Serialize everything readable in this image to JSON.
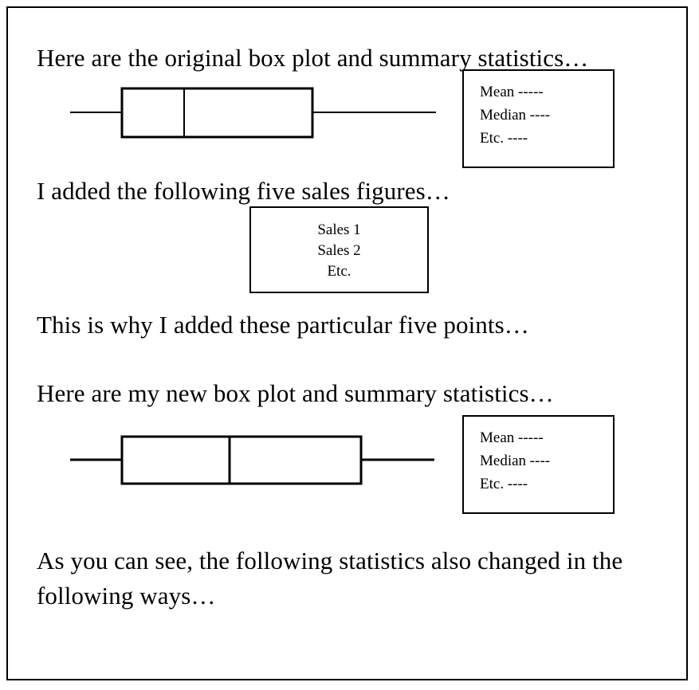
{
  "document": {
    "title": "Box plot comparison slide",
    "border_color": "#000000",
    "background_color": "#ffffff",
    "text_color": "#000000"
  },
  "paragraphs": [
    {
      "id": "line-1",
      "text": "Here are the original box plot and summary statistics…"
    },
    {
      "id": "line-2",
      "text": "I added the following five sales figures…"
    },
    {
      "id": "line-3",
      "text": "This is why I added these particular five points…"
    },
    {
      "id": "line-4",
      "text": "Here are my new box plot and summary statistics…"
    },
    {
      "id": "line-5",
      "text": "As you can see, the following statistics also changed in the following ways…"
    }
  ],
  "stats_box_original": {
    "lines": [
      "Mean -----",
      "Median ----",
      "Etc. ----"
    ]
  },
  "stats_box_new": {
    "lines": [
      "Mean -----",
      "Median ----",
      "Etc. ----"
    ]
  },
  "sales_box": {
    "lines": [
      "Sales 1",
      "Sales 2",
      "Etc."
    ]
  },
  "chart_data": [
    {
      "type": "boxplot",
      "name": "original-box-plot",
      "title": "",
      "orientation": "horizontal",
      "xlabel": "",
      "ylabel": "",
      "grid": false,
      "legend": "none",
      "axis_shown": false,
      "tick_labels": [],
      "line_color": "#000000",
      "fill_color": "#ffffff",
      "series": [
        {
          "name": "original",
          "min": 0.0,
          "q1": 14.2,
          "median": 31.0,
          "q3": 66.4,
          "max": 100.0
        }
      ]
    },
    {
      "type": "boxplot",
      "name": "new-box-plot",
      "title": "",
      "orientation": "horizontal",
      "xlabel": "",
      "ylabel": "",
      "grid": false,
      "legend": "none",
      "axis_shown": false,
      "tick_labels": [],
      "line_color": "#000000",
      "fill_color": "#ffffff",
      "series": [
        {
          "name": "new",
          "min": 0.0,
          "q1": 14.2,
          "median": 43.7,
          "q3": 79.9,
          "max": 100.0
        }
      ]
    }
  ]
}
